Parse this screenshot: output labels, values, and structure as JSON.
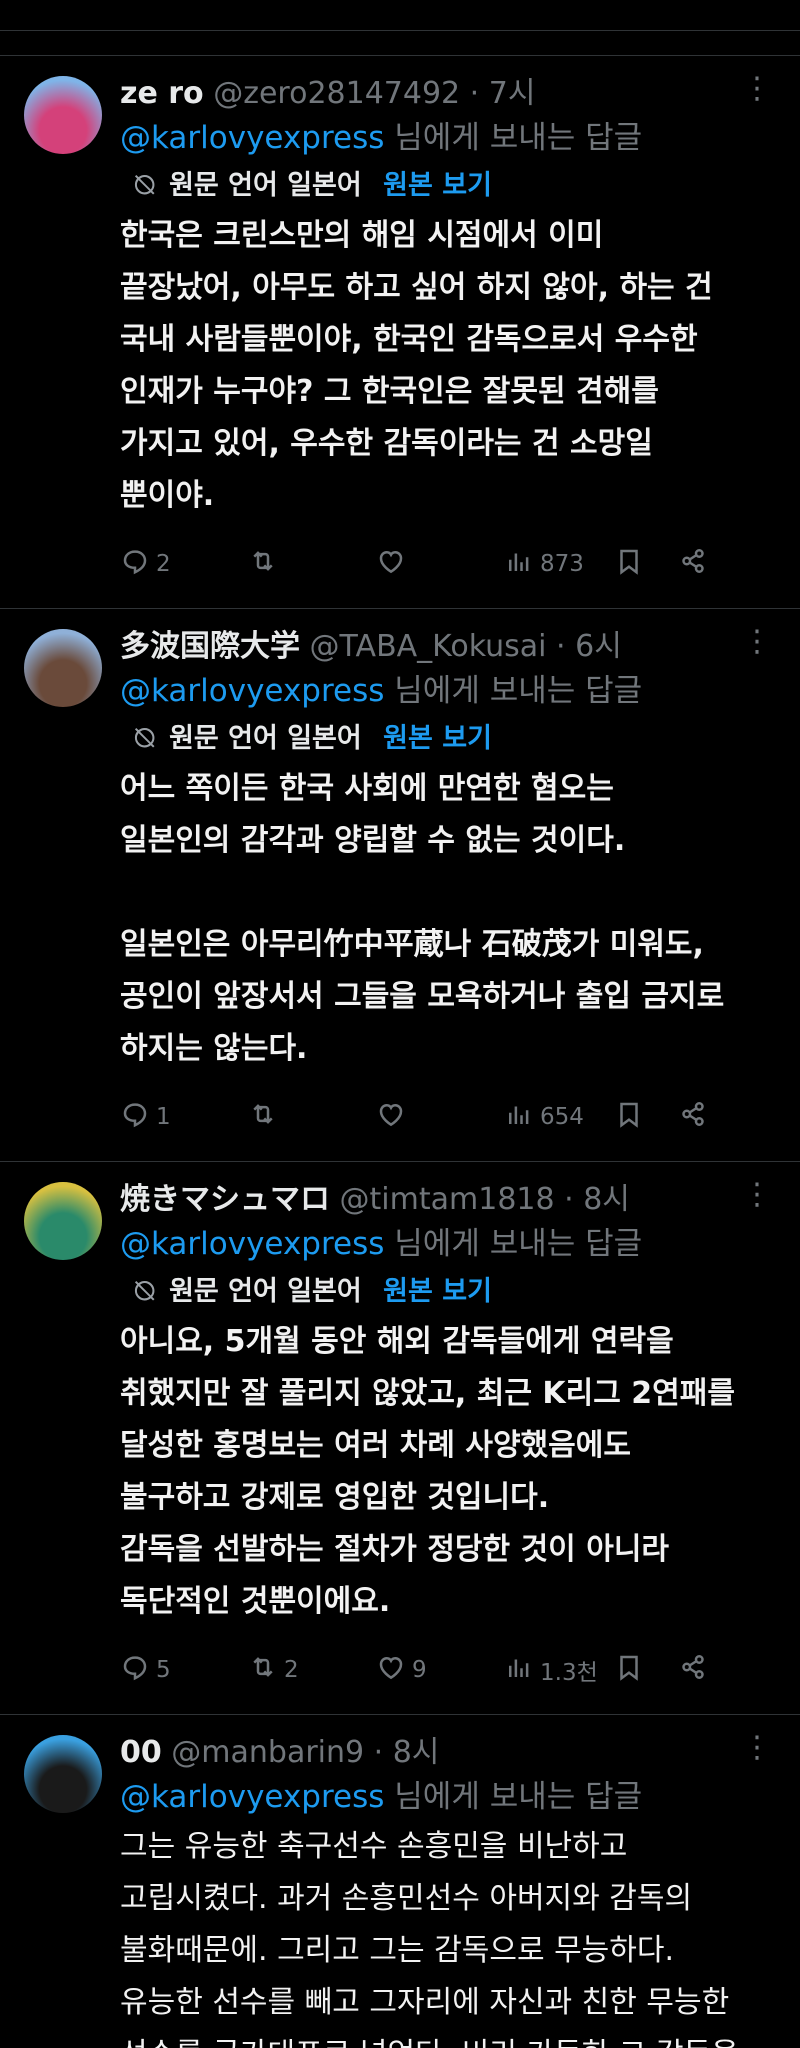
{
  "reply_prefix_suffix": "님에게 보내는 답글",
  "translate": {
    "label": "원문 언어 일본어",
    "show": "원본 보기"
  },
  "tweets": [
    {
      "name": "ze ro",
      "handle": "@zero28147492 · 7시",
      "reply_to": "@karlovyexpress",
      "translated": true,
      "body": "한국은 크린스만의 해임 시점에서 이미\n끝장났어, 아무도 하고 싶어 하지 않아, 하는 건\n국내 사람들뿐이야, 한국인 감독으로서 우수한\n인재가 누구야? 그 한국인은 잘못된 견해를\n가지고 있어, 우수한 감독이라는 건 소망일\n뿐이야.",
      "replies": "2",
      "retweets": "",
      "likes": "",
      "views": "873",
      "avatar_colors": [
        "#d4417a",
        "#7fb4e8"
      ]
    },
    {
      "name": "多波国際大学",
      "handle": "@TABA_Kokusai · 6시",
      "reply_to": "@karlovyexpress",
      "translated": true,
      "body": "어느 쪽이든 한국 사회에 만연한 혐오는\n일본인의 감각과 양립할 수 없는 것이다.\n\n일본인은 아무리竹中平蔵나 石破茂가 미워도,\n공인이 앞장서서 그들을 모욕하거나 출입 금지로\n하지는 않는다.",
      "replies": "1",
      "retweets": "",
      "likes": "",
      "views": "654",
      "avatar_colors": [
        "#6a4a3a",
        "#8fb0d8"
      ]
    },
    {
      "name": "焼きマシュマロ",
      "handle": "@timtam1818 · 8시",
      "reply_to": "@karlovyexpress",
      "translated": true,
      "body": "아니요, 5개월 동안 해외 감독들에게 연락을\n취했지만 잘 풀리지 않았고, 최근 K리그 2연패를\n달성한 홍명보는 여러 차례 사양했음에도\n불구하고 강제로 영입한 것입니다.\n감독을 선발하는 절차가 정당한 것이 아니라\n독단적인 것뿐이에요.",
      "replies": "5",
      "retweets": "2",
      "likes": "9",
      "views": "1.3천",
      "avatar_colors": [
        "#2a8a6a",
        "#d8c040"
      ]
    },
    {
      "name": "00",
      "handle": "@manbarin9 · 8시",
      "reply_to": "@karlovyexpress",
      "translated": false,
      "body": "그는 유능한 축구선수 손흥민을 비난하고\n고립시켰다. 과거 손흥민선수 아버지와 감독의\n불화때문에. 그리고 그는 감독으로 무능하다.\n유능한 선수를 빼고 그자리에 자신과 친한 무능한\n선수를 국가대표로 넣었다. 비리 가득한 그 감독을",
      "replies": "",
      "retweets": "",
      "likes": "",
      "views": "",
      "avatar_colors": [
        "#1a1a1a",
        "#3aa0e0"
      ]
    }
  ]
}
